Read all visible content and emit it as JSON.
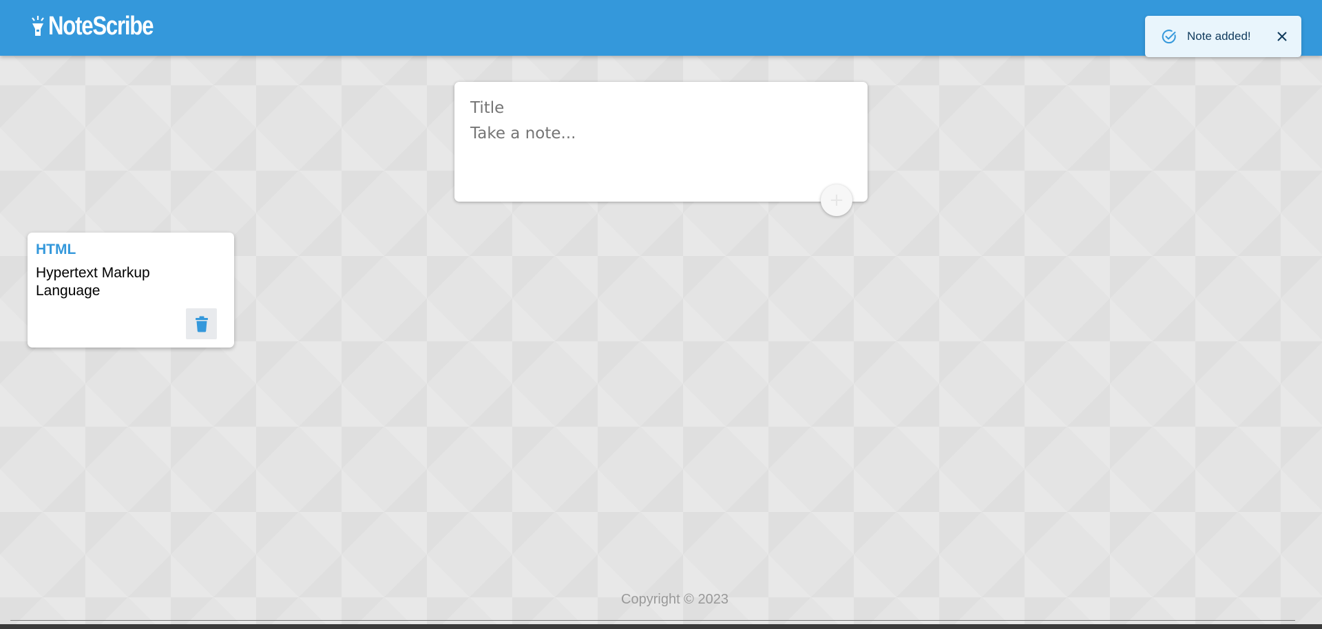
{
  "header": {
    "brand": "NoteScribe",
    "brand_icon": "flashlight-icon",
    "background_color": "#3498db"
  },
  "toast": {
    "message": "Note added!",
    "icon": "check-circle-icon",
    "close_icon": "close-icon",
    "accent_color": "#3498db"
  },
  "composer": {
    "title_placeholder": "Title",
    "content_placeholder": "Take a note...",
    "add_icon": "plus-icon"
  },
  "notes": [
    {
      "title": "HTML",
      "content": "Hypertext Markup Language",
      "delete_icon": "trash-icon"
    }
  ],
  "footer": {
    "text": "Copyright © 2023"
  }
}
